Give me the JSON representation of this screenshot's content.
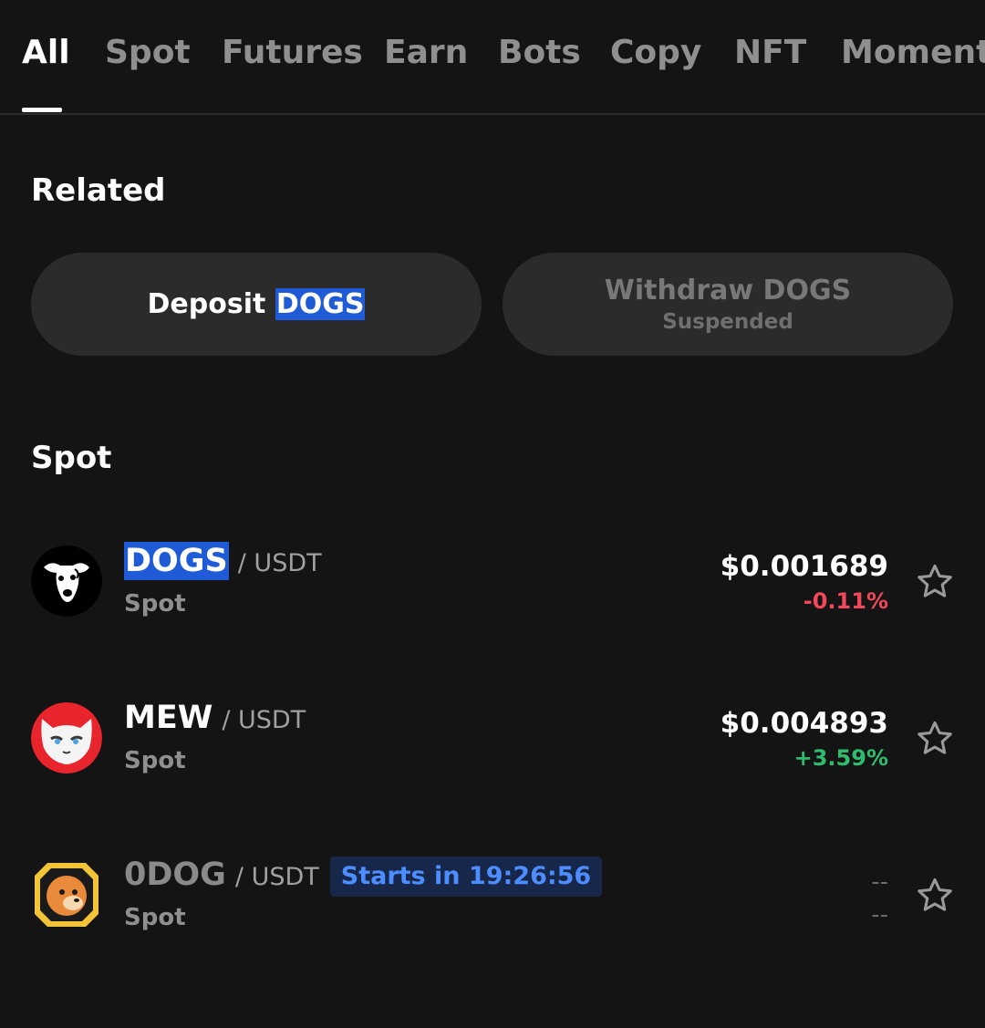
{
  "tabs": [
    {
      "label": "All",
      "active": true
    },
    {
      "label": "Spot"
    },
    {
      "label": "Futures"
    },
    {
      "label": "Earn"
    },
    {
      "label": "Bots"
    },
    {
      "label": "Copy"
    },
    {
      "label": "NFT"
    },
    {
      "label": "Moments"
    }
  ],
  "related": {
    "title": "Related",
    "deposit": {
      "prefix": "Deposit",
      "highlight": "DOGS"
    },
    "withdraw": {
      "label": "Withdraw DOGS",
      "status": "Suspended"
    }
  },
  "spot": {
    "title": "Spot",
    "rows": [
      {
        "base": "DOGS",
        "quote": "/ USDT",
        "type": "Spot",
        "price": "$0.001689",
        "change": "-0.11%",
        "change_color": "#f0485a",
        "icon": "dogs-logo-icon",
        "base_highlighted": true
      },
      {
        "base": "MEW",
        "quote": "/ USDT",
        "type": "Spot",
        "price": "$0.004893",
        "change": "+3.59%",
        "change_color": "#2ebd6e",
        "icon": "mew-logo-icon"
      },
      {
        "base": "0DOG",
        "quote": "/ USDT",
        "type": "Spot",
        "badge": "Starts in 19:26:56",
        "price": "--",
        "change": "--",
        "icon": "0dog-logo-icon"
      }
    ]
  },
  "colors": {
    "background": "#141414",
    "highlight": "#1f5bd6",
    "badge_text": "#4d8dff",
    "negative": "#f0485a",
    "positive": "#2ebd6e"
  },
  "icons": [
    "star-outline-icon"
  ]
}
